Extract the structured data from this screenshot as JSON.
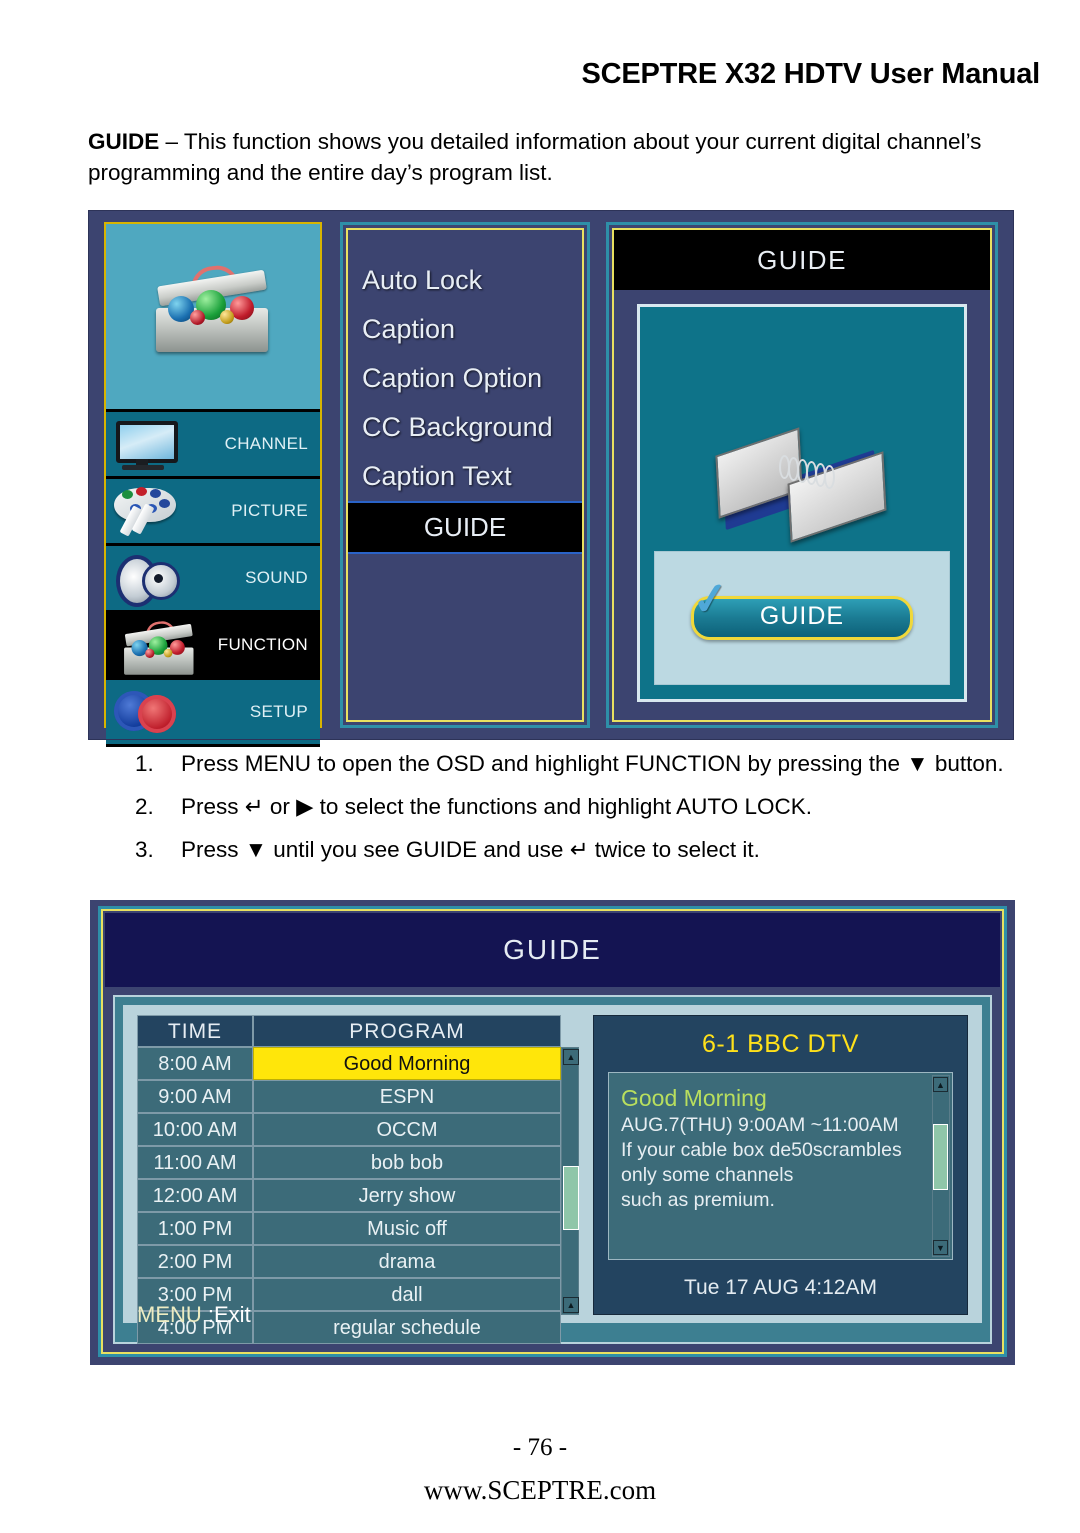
{
  "header": {
    "title": "SCEPTRE X32 HDTV User Manual"
  },
  "intro": {
    "lead": "GUIDE",
    "body": " – This function shows you detailed information about your current digital channel’s programming and the entire day’s program list."
  },
  "osd": {
    "icon_menu": {
      "hero_icon": "toolbox-icon",
      "items": [
        {
          "label": "CHANNEL",
          "icon": "tv-icon",
          "selected": false
        },
        {
          "label": "PICTURE",
          "icon": "palette-icon",
          "selected": false
        },
        {
          "label": "SOUND",
          "icon": "speaker-icon",
          "selected": false
        },
        {
          "label": "FUNCTION",
          "icon": "toolbox-icon",
          "selected": true
        },
        {
          "label": "SETUP",
          "icon": "gears-icon",
          "selected": false
        }
      ]
    },
    "function_list": {
      "items": [
        {
          "label": "Auto Lock",
          "selected": false
        },
        {
          "label": "Caption",
          "selected": false
        },
        {
          "label": "Caption Option",
          "selected": false
        },
        {
          "label": "CC Background",
          "selected": false
        },
        {
          "label": "Caption Text",
          "selected": false
        },
        {
          "label": "GUIDE",
          "selected": true
        }
      ]
    },
    "preview": {
      "title": "GUIDE",
      "illustration": "open-book-icon",
      "cta_label": "GUIDE",
      "cta_icon": "checkmark-icon"
    }
  },
  "steps": [
    {
      "num": "1.",
      "text": "Press MENU to open the OSD and highlight FUNCTION by pressing the ▼ button."
    },
    {
      "num": "2.",
      "text": "Press ↵ or ▶ to select the functions and highlight AUTO LOCK."
    },
    {
      "num": "3.",
      "text": "Press ▼ until you see GUIDE and use ↵ twice to select it."
    }
  ],
  "guide_screen": {
    "title": "GUIDE",
    "table": {
      "columns": [
        "TIME",
        "PROGRAM"
      ],
      "rows": [
        {
          "time": "8:00 AM",
          "program": "Good Morning",
          "highlighted": true
        },
        {
          "time": "9:00 AM",
          "program": "ESPN",
          "highlighted": false
        },
        {
          "time": "10:00 AM",
          "program": "OCCM",
          "highlighted": false
        },
        {
          "time": "11:00 AM",
          "program": "bob bob",
          "highlighted": false
        },
        {
          "time": "12:00 AM",
          "program": "Jerry show",
          "highlighted": false
        },
        {
          "time": "1:00 PM",
          "program": "Music off",
          "highlighted": false
        },
        {
          "time": "2:00 PM",
          "program": "drama",
          "highlighted": false
        },
        {
          "time": "3:00 PM",
          "program": "dall",
          "highlighted": false
        },
        {
          "time": "4:00 PM",
          "program": "regular  schedule",
          "highlighted": false
        }
      ],
      "scroll_up_icon": "triangle-up-icon",
      "scroll_down_icon": "triangle-up-icon"
    },
    "detail": {
      "channel": "6-1 BBC DTV",
      "program_title": "Good Morning",
      "airtime": "AUG.7(THU) 9:00AM ~11:00AM",
      "description_lines": [
        "If your cable box de50scrambles",
        "only some channels",
        "such as premium."
      ],
      "clock": "Tue 17 AUG 4:12AM",
      "scroll_up_icon": "triangle-up-icon",
      "scroll_down_icon": "triangle-down-icon"
    },
    "footer_hint_key": "MENU ",
    "footer_hint_action": ":Exit"
  },
  "footer": {
    "page": "- 76 -",
    "site": "www.SCEPTRE.com"
  },
  "colors": {
    "osd_bg": "#3c4470",
    "panel_border_teal": "#2e8fa8",
    "panel_border_yellow": "#e8e060",
    "highlight_yellow": "#ffe60a",
    "guide_title_navy": "#141452",
    "channel_yellow": "#ffe11a",
    "program_green": "#b9df5e"
  }
}
